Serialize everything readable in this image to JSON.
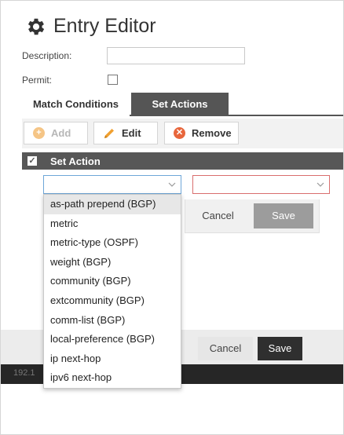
{
  "dialog": {
    "title": "Entry Editor",
    "title_icon": "gear-icon"
  },
  "form": {
    "description_label": "Description:",
    "description_value": "",
    "permit_label": "Permit:",
    "permit_checked": false
  },
  "tabs": [
    {
      "label": "Match Conditions",
      "active": false
    },
    {
      "label": "Set Actions",
      "active": true
    }
  ],
  "toolbar": {
    "add_label": "Add",
    "edit_label": "Edit",
    "remove_label": "Remove"
  },
  "grid": {
    "column_header": "Set Action"
  },
  "row_editor": {
    "action_value": "",
    "value_value": "",
    "cancel_label": "Cancel",
    "save_label": "Save"
  },
  "dropdown": {
    "highlighted_index": 0,
    "options": [
      "as-path prepend (BGP)",
      "metric",
      "metric-type (OSPF)",
      "weight (BGP)",
      "community (BGP)",
      "extcommunity (BGP)",
      "comm-list (BGP)",
      "local-preference (BGP)",
      "ip next-hop",
      "ipv6 next-hop"
    ]
  },
  "footer": {
    "cancel_label": "Cancel",
    "save_label": "Save"
  },
  "statusbar": {
    "text": "192.1"
  },
  "colors": {
    "active_tab": "#555555",
    "grid_header": "#575757",
    "save_primary": "#2f2f2f",
    "save_disabled": "#9c9c9c",
    "remove_icon": "#e8663c",
    "add_icon_disabled": "#f5c586",
    "edit_icon": "#f0a030",
    "action_select_border": "#6ea6d8",
    "value_select_border_error": "#d96e6e"
  }
}
